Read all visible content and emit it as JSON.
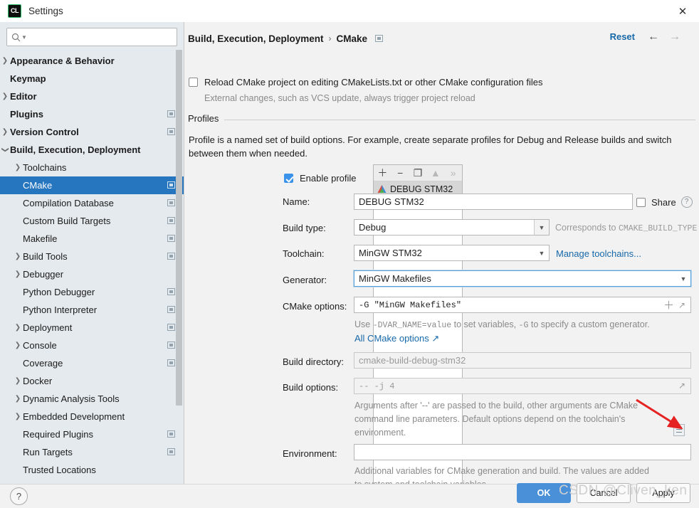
{
  "window": {
    "title": "Settings",
    "app_icon": "clion-logo-icon",
    "close_icon": "close-icon"
  },
  "sidebar": {
    "search": {
      "placeholder": "",
      "value": "",
      "icon": "search-icon"
    },
    "items": [
      {
        "label": "Appearance & Behavior",
        "arrow": "collapsed",
        "bold": true,
        "indent": 10,
        "scope": false,
        "selected": false
      },
      {
        "label": "Keymap",
        "arrow": "none",
        "bold": true,
        "indent": 10,
        "scope": false,
        "selected": false
      },
      {
        "label": "Editor",
        "arrow": "collapsed",
        "bold": true,
        "indent": 10,
        "scope": false,
        "selected": false
      },
      {
        "label": "Plugins",
        "arrow": "none",
        "bold": true,
        "indent": 10,
        "scope": true,
        "selected": false
      },
      {
        "label": "Version Control",
        "arrow": "collapsed",
        "bold": true,
        "indent": 10,
        "scope": true,
        "selected": false
      },
      {
        "label": "Build, Execution, Deployment",
        "arrow": "expanded",
        "bold": true,
        "indent": 10,
        "scope": false,
        "selected": false
      },
      {
        "label": "Toolchains",
        "arrow": "collapsed",
        "bold": false,
        "indent": 28,
        "scope": false,
        "selected": false
      },
      {
        "label": "CMake",
        "arrow": "none",
        "bold": false,
        "indent": 28,
        "scope": true,
        "selected": true
      },
      {
        "label": "Compilation Database",
        "arrow": "none",
        "bold": false,
        "indent": 28,
        "scope": true,
        "selected": false
      },
      {
        "label": "Custom Build Targets",
        "arrow": "none",
        "bold": false,
        "indent": 28,
        "scope": true,
        "selected": false
      },
      {
        "label": "Makefile",
        "arrow": "none",
        "bold": false,
        "indent": 28,
        "scope": true,
        "selected": false
      },
      {
        "label": "Build Tools",
        "arrow": "collapsed",
        "bold": false,
        "indent": 28,
        "scope": true,
        "selected": false
      },
      {
        "label": "Debugger",
        "arrow": "collapsed",
        "bold": false,
        "indent": 28,
        "scope": false,
        "selected": false
      },
      {
        "label": "Python Debugger",
        "arrow": "none",
        "bold": false,
        "indent": 28,
        "scope": true,
        "selected": false
      },
      {
        "label": "Python Interpreter",
        "arrow": "none",
        "bold": false,
        "indent": 28,
        "scope": true,
        "selected": false
      },
      {
        "label": "Deployment",
        "arrow": "collapsed",
        "bold": false,
        "indent": 28,
        "scope": true,
        "selected": false
      },
      {
        "label": "Console",
        "arrow": "collapsed",
        "bold": false,
        "indent": 28,
        "scope": true,
        "selected": false
      },
      {
        "label": "Coverage",
        "arrow": "none",
        "bold": false,
        "indent": 28,
        "scope": true,
        "selected": false
      },
      {
        "label": "Docker",
        "arrow": "collapsed",
        "bold": false,
        "indent": 28,
        "scope": false,
        "selected": false
      },
      {
        "label": "Dynamic Analysis Tools",
        "arrow": "collapsed",
        "bold": false,
        "indent": 28,
        "scope": false,
        "selected": false
      },
      {
        "label": "Embedded Development",
        "arrow": "collapsed",
        "bold": false,
        "indent": 28,
        "scope": false,
        "selected": false
      },
      {
        "label": "Required Plugins",
        "arrow": "none",
        "bold": false,
        "indent": 28,
        "scope": true,
        "selected": false
      },
      {
        "label": "Run Targets",
        "arrow": "none",
        "bold": false,
        "indent": 28,
        "scope": true,
        "selected": false
      },
      {
        "label": "Trusted Locations",
        "arrow": "none",
        "bold": false,
        "indent": 28,
        "scope": false,
        "selected": false
      }
    ]
  },
  "header": {
    "breadcrumb_root": "Build, Execution, Deployment",
    "breadcrumb_sep": "›",
    "breadcrumb_leaf": "CMake",
    "scope_icon": "project-scope-icon",
    "reset_label": "Reset",
    "back_icon": "arrow-left-icon",
    "forward_icon": "arrow-right-icon"
  },
  "main": {
    "reload_checkbox": {
      "label": "Reload CMake project on editing CMakeLists.txt or other CMake configuration files",
      "checked": false
    },
    "reload_sub": "External changes, such as VCS update, always trigger project reload",
    "profiles_group_title": "Profiles",
    "profiles_description": "Profile is a named set of build options. For example, create separate profiles for Debug and Release builds and switch between them when needed.",
    "profile_list": {
      "toolbar": [
        {
          "icon": "add-icon",
          "glyph": "＋",
          "disabled": false
        },
        {
          "icon": "remove-icon",
          "glyph": "−",
          "disabled": false
        },
        {
          "icon": "copy-icon",
          "glyph": "❐",
          "disabled": false
        },
        {
          "icon": "move-up-icon",
          "glyph": "▲",
          "disabled": true
        },
        {
          "icon": "more-icon",
          "glyph": "»",
          "disabled": true
        }
      ],
      "rows": [
        {
          "name": "DEBUG STM32",
          "icon": "cmake-profile-icon"
        }
      ]
    },
    "enable_profile": {
      "label": "Enable profile",
      "checked": true
    },
    "fields": {
      "name": {
        "label": "Name:",
        "value": "DEBUG STM32"
      },
      "share": {
        "label": "Share",
        "checked": false,
        "help_icon": "help-circle-icon"
      },
      "build_type": {
        "label": "Build type:",
        "value": "Debug",
        "note": "Corresponds to ",
        "note_mono": "CMAKE_BUILD_TYPE"
      },
      "toolchain": {
        "label": "Toolchain:",
        "value": "MinGW STM32",
        "link": "Manage toolchains..."
      },
      "generator": {
        "label": "Generator:",
        "value": "MinGW Makefiles",
        "focused": true
      },
      "cmake_options": {
        "label": "CMake options:",
        "value": "-G \"MinGW Makefiles\"",
        "add_icon": "plus-icon",
        "expand_icon": "expand-icon",
        "hint_prefix": "Use ",
        "hint_mono1": "-DVAR_NAME=value",
        "hint_mid": " to set variables, ",
        "hint_mono2": "-G",
        "hint_suffix": " to specify a custom generator.",
        "hint_link": "All CMake options ↗"
      },
      "build_directory": {
        "label": "Build directory:",
        "placeholder": "cmake-build-debug-stm32",
        "value": "",
        "browse_icon": "folder-icon"
      },
      "build_options": {
        "label": "Build options:",
        "placeholder": "-- -j 4",
        "value": "",
        "expand_icon": "expand-icon",
        "hint": "Arguments after '--' are passed to the build, other arguments are CMake command line parameters. Default options depend on the toolchain's environment."
      },
      "environment": {
        "label": "Environment:",
        "value": "",
        "editor_icon": "list-editor-icon",
        "hint": "Additional variables for CMake generation and build. The values are added to system and toolchain variables."
      }
    },
    "annotation": {
      "type": "red-arrow",
      "color": "#e52323"
    }
  },
  "footer": {
    "help_icon": "help-icon",
    "ok_label": "OK",
    "cancel_label": "Cancel",
    "apply_label": "Apply",
    "watermark": "CSDN @Cliven_ken"
  },
  "colors": {
    "accent": "#2675bf",
    "ok_button": "#4a90d9",
    "link": "#1769aa",
    "sidebar_bg": "#e4eaee",
    "annotation_red": "#e52323"
  }
}
